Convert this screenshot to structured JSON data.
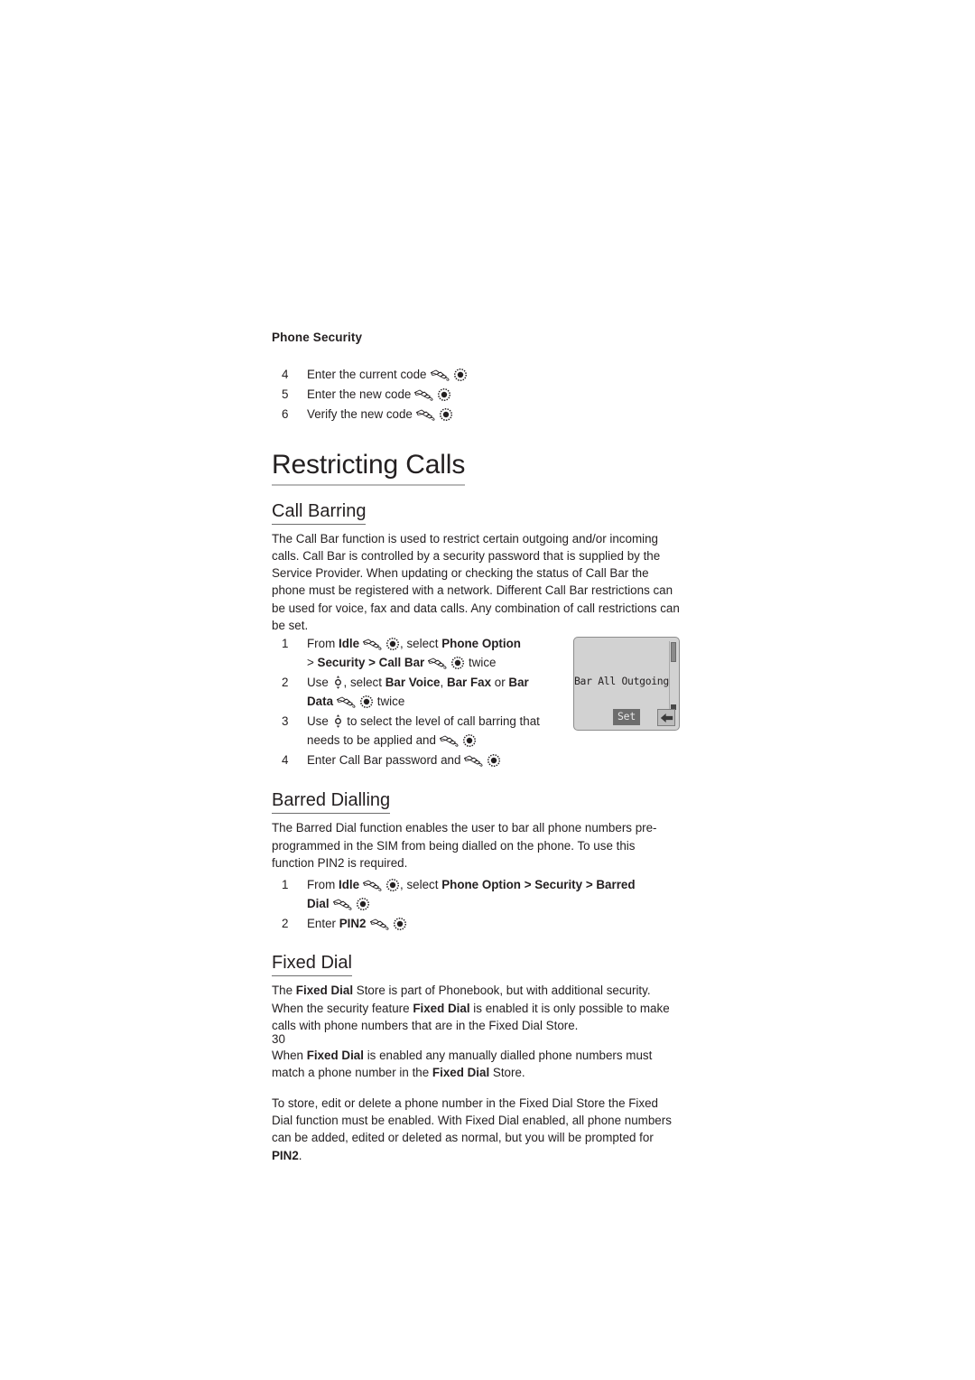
{
  "document": {
    "running_head": "Phone Security",
    "page_number": "30"
  },
  "phone_security_steps": [
    {
      "num": "4",
      "text": "Enter the current code"
    },
    {
      "num": "5",
      "text": "Enter the new code"
    },
    {
      "num": "6",
      "text": "Verify the new code"
    }
  ],
  "restricting_calls": {
    "title": "Restricting Calls",
    "call_barring": {
      "heading": "Call Barring",
      "paragraph": "The Call Bar function is used to restrict certain outgoing and/or incoming calls. Call Bar is controlled by a security password that is supplied by  the Service Provider. When updating or checking the status of Call Bar the phone must be registered with a network. Different Call Bar restrictions can be used for voice, fax and data calls. Any combination of call restrictions can be set.",
      "steps": {
        "s1_num": "1",
        "s1_a": "From ",
        "s1_idle": "Idle",
        "s1_b": ", select ",
        "s1_phone_option": "Phone Option",
        "s1_gt1": "> ",
        "s1_security": "Security",
        "s1_gt2": " > ",
        "s1_call_bar": "Call Bar",
        "s1_twice": "twice",
        "s2_num": "2",
        "s2_use": "Use ",
        "s2_select": ", select ",
        "s2_bar_voice": "Bar Voice",
        "s2_comma": ", ",
        "s2_bar_fax": "Bar Fax",
        "s2_or": " or ",
        "s2_bar": "Bar",
        "s2_data": "Data",
        "s2_twice": "twice",
        "s3_num": "3",
        "s3_use": "Use ",
        "s3_text": " to select the level of call barring that needs to be applied and",
        "s4_num": "4",
        "s4_text": "Enter Call Bar password and"
      },
      "phone_screen": {
        "display_text": "Bar All Outgoing",
        "softkey_left": "Set",
        "softkey_right_icon": "back-arrow-icon"
      }
    },
    "barred_dialling": {
      "heading": "Barred Dialling",
      "paragraph": "The Barred Dial function enables the user to bar all phone numbers pre-programmed in the SIM from being dialled on the phone. To use this function PIN2 is required.",
      "steps": {
        "s1_num": "1",
        "s1_a": "From ",
        "s1_idle": "Idle",
        "s1_b": ", select ",
        "s1_phone_option": "Phone Option",
        "s1_gt1": " > ",
        "s1_security": "Security",
        "s1_gt2": " > ",
        "s1_barred": "Barred",
        "s1_dial": "Dial",
        "s2_num": "2",
        "s2_enter": "Enter ",
        "s2_pin2": "PIN2"
      }
    },
    "fixed_dial": {
      "heading": "Fixed Dial",
      "p1_a": "The ",
      "p1_b1": "Fixed Dial",
      "p1_c": " Store is part of Phonebook, but with additional security. When the security feature ",
      "p1_b2": "Fixed Dial",
      "p1_d": " is enabled it is only possible to make calls with phone numbers that are in the Fixed Dial Store.",
      "p2_a": "When ",
      "p2_b1": "Fixed Dial",
      "p2_c": " is enabled any manually dialled phone numbers must match a phone number in the ",
      "p2_b2": "Fixed Dial",
      "p2_d": " Store.",
      "p3_a": "To store, edit or delete a phone number in the Fixed Dial Store the Fixed Dial function must be enabled. With Fixed Dial enabled, all phone numbers can be added, edited or deleted as normal, but you will be prompted for ",
      "p3_b": "PIN2",
      "p3_c": "."
    }
  },
  "icons": {
    "hand": "hand-press-icon",
    "ok_key": "ok-key-icon",
    "nav_key": "navigation-key-icon"
  }
}
